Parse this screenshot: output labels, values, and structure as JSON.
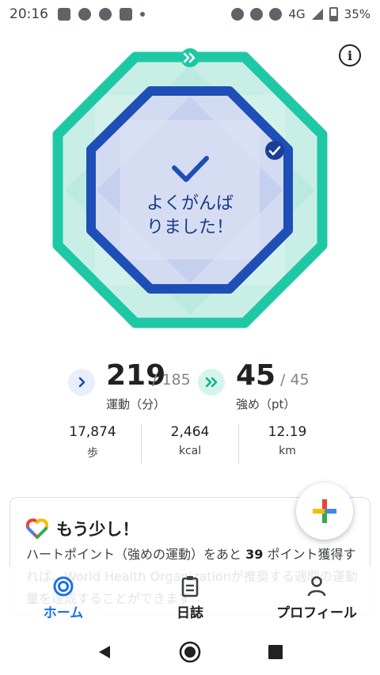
{
  "status_bar": {
    "time": "20:16",
    "network": "4G",
    "battery": "35%"
  },
  "ring": {
    "message_line1": "よくがんば",
    "message_line2": "りました！",
    "outer_color": "#1fc8a5",
    "inner_color": "#1e4fb7"
  },
  "move_minutes": {
    "value": "219",
    "goal": "/ 185",
    "label": "運動（分）"
  },
  "heart_points": {
    "value": "45",
    "goal": "/ 45",
    "label": "強め（pt）"
  },
  "metrics": [
    {
      "value": "17,874",
      "unit": "歩"
    },
    {
      "value": "2,464",
      "unit": "kcal"
    },
    {
      "value": "12.19",
      "unit": "km"
    }
  ],
  "card": {
    "title": "もう少し！",
    "body_prefix": "ハートポイント（強めの運動）をあと",
    "body_bold": "39",
    "body_suffix": "ポイント獲得すれば、World Health Organizationが推奨する週間の運動量を達成することができます"
  },
  "bottom_nav": {
    "home": "ホーム",
    "journal": "日誌",
    "profile": "プロフィール"
  }
}
